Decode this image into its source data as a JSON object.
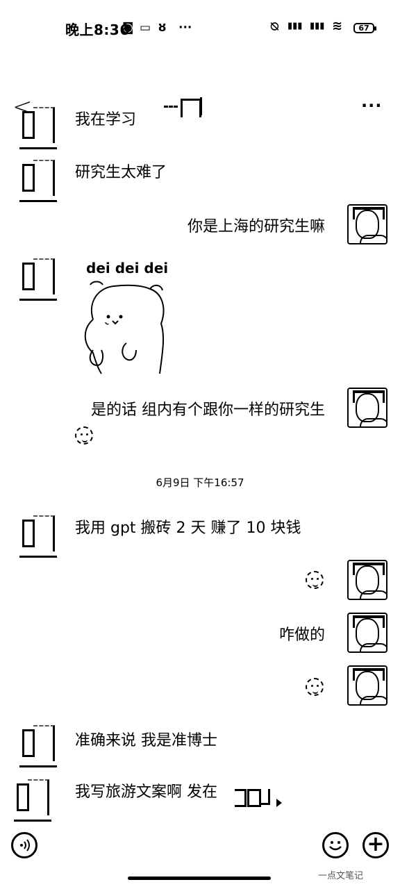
{
  "status": {
    "time": "晚上8:36",
    "icons_left": [
      "app-icon",
      "message-icon",
      "notification-icon"
    ],
    "more": "···",
    "battery": "67"
  },
  "header": {
    "back": "<",
    "title": "",
    "more": "···"
  },
  "messages": [
    {
      "side": "left",
      "text": "我在学习"
    },
    {
      "side": "left",
      "text": "研究生太难了"
    },
    {
      "side": "right",
      "text": "你是上海的研究生嘛"
    },
    {
      "side": "left",
      "text": "dei dei dei",
      "sticker": true
    },
    {
      "side": "right",
      "text": "是的话 组内有个跟你一样的研究生"
    },
    {
      "side": "left",
      "text": "我用 gpt 搬砖 2 天 赚了 10 块钱"
    },
    {
      "side": "right",
      "text": ""
    },
    {
      "side": "right",
      "text": "咋做的"
    },
    {
      "side": "right",
      "text": ""
    },
    {
      "side": "left",
      "text": "准确来说 我是准博士"
    },
    {
      "side": "left",
      "text": "我写旅游文案啊 发在"
    }
  ],
  "timestamp": "6月9日 下午16:57",
  "bottom": {
    "voice": "voice-icon",
    "emoji": "emoji-icon",
    "plus": "+"
  },
  "watermark": "一点文笔记"
}
